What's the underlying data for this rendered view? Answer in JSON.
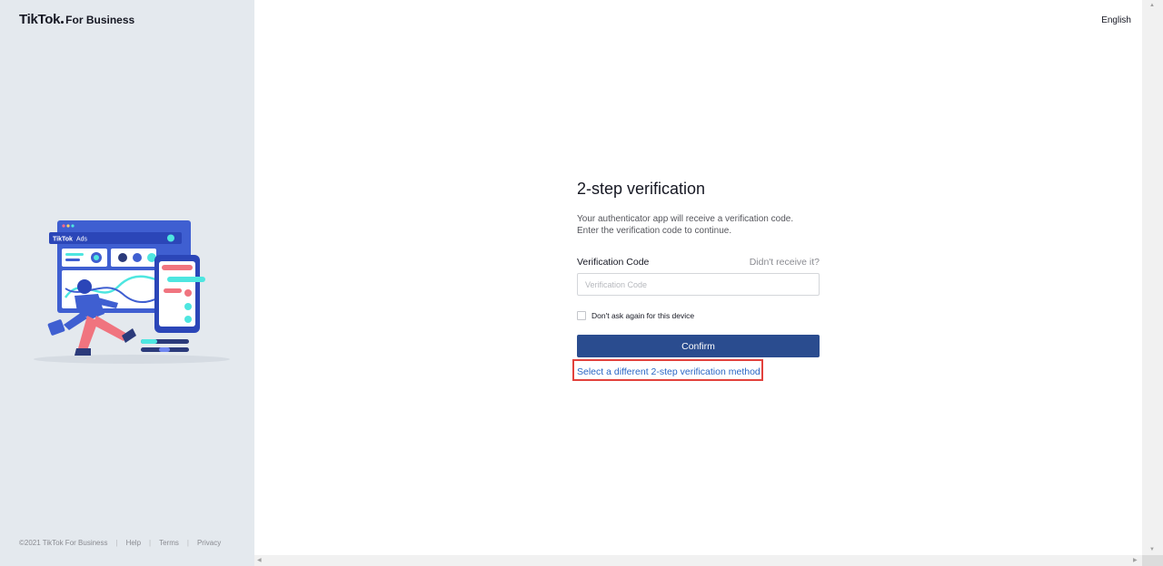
{
  "brand": {
    "name": "TikTok",
    "suffix": "For Business"
  },
  "language": "English",
  "illustration": {
    "browser_label_brand": "TikTok",
    "browser_label_product": "Ads"
  },
  "form": {
    "title": "2-step verification",
    "description_line1": "Your authenticator app will receive a verification code.",
    "description_line2": "Enter the verification code to continue.",
    "code_label": "Verification Code",
    "resend_link": "Didn't receive it?",
    "code_value": "",
    "code_placeholder": "Verification Code",
    "remember_label": "Don't ask again for this device",
    "confirm_label": "Confirm",
    "alt_method_link": "Select a different 2-step verification method"
  },
  "footer": {
    "copyright": "©2021 TikTok For Business",
    "links": [
      "Help",
      "Terms",
      "Privacy"
    ]
  },
  "colors": {
    "primary_button": "#2a4c8f",
    "link": "#2a66c4",
    "highlight_box": "#e2423d",
    "left_panel_bg": "#e4e9ee"
  }
}
